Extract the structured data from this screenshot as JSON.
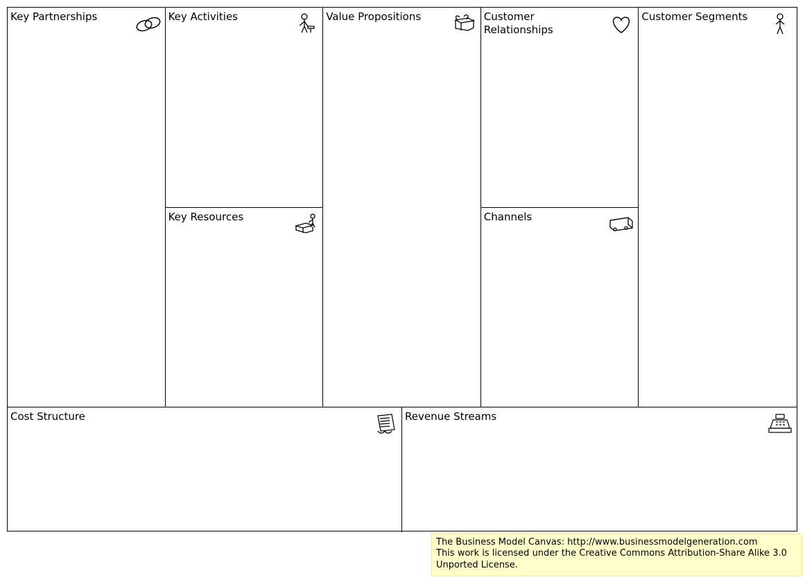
{
  "cells": {
    "key_partnerships": "Key Partnerships",
    "key_activities": "Key Activities",
    "key_resources": "Key Resources",
    "value_propositions": "Value Propositions",
    "customer_relationships": "Customer Relationships",
    "channels": "Channels",
    "customer_segments": "Customer Segments",
    "cost_structure": "Cost Structure",
    "revenue_streams": "Revenue Streams"
  },
  "attribution": {
    "line1": "The Business Model Canvas: http://www.businessmodelgeneration.com",
    "line2": "This work is licensed under the Creative Commons Attribution-Share Alike 3.0 Unported License."
  }
}
